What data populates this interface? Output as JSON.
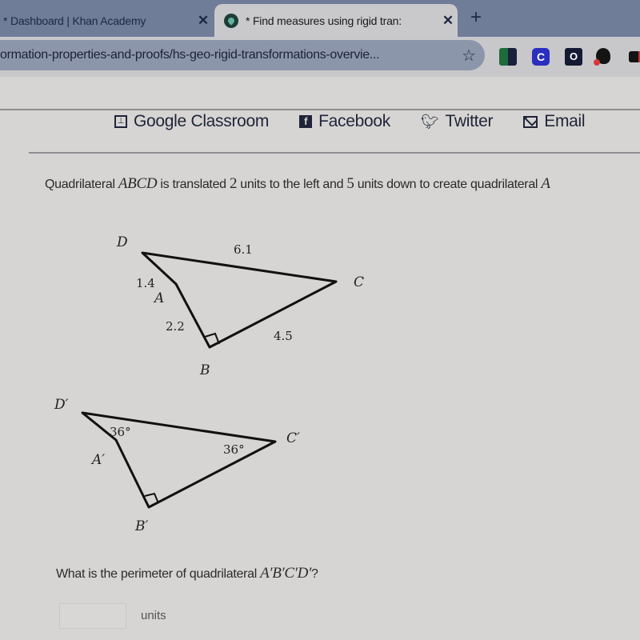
{
  "browser": {
    "tabs": [
      {
        "title": "* Dashboard | Khan Academy",
        "active": false,
        "close_label": "✕"
      },
      {
        "title": "* Find measures using rigid tran:",
        "active": true,
        "close_label": "✕"
      }
    ],
    "new_tab_label": "+",
    "url": "ormation-properties-and-proofs/hs-geo-rigid-transformations-overvie...",
    "star_icon": "☆",
    "extensions": [
      {
        "name": "green-navy-extension",
        "glyph": ""
      },
      {
        "name": "c-extension",
        "glyph": "C"
      },
      {
        "name": "o-extension",
        "glyph": "O"
      },
      {
        "name": "blob-extension",
        "glyph": ""
      },
      {
        "name": "red-extension",
        "glyph": ""
      }
    ]
  },
  "share": {
    "items": [
      {
        "label": "Google Classroom",
        "icon": "classroom-icon"
      },
      {
        "label": "Facebook",
        "icon": "facebook-icon"
      },
      {
        "label": "Twitter",
        "icon": "twitter-icon"
      },
      {
        "label": "Email",
        "icon": "email-icon"
      }
    ]
  },
  "question": {
    "part1": "Quadrilateral ",
    "shape1": "ABCD",
    "part2": " is translated ",
    "n1": "2",
    "part3": " units to the left and ",
    "n2": "5",
    "part4": " units down to create quadrilateral ",
    "shape2": "A"
  },
  "figure_original": {
    "vertices": {
      "A": "A",
      "B": "B",
      "C": "C",
      "D": "D"
    },
    "sides": {
      "DC": "6.1",
      "DA": "1.4",
      "AB": "2.2",
      "BC": "4.5"
    },
    "right_angle_at": "B"
  },
  "figure_image": {
    "vertices": {
      "A": "A′",
      "B": "B′",
      "C": "C′",
      "D": "D′"
    },
    "angles": {
      "D": "36°",
      "C": "36°"
    },
    "right_angle_at": "B′"
  },
  "prompt": {
    "text": "What is the perimeter of quadrilateral ",
    "shape": "A′B′C′D′",
    "end": "?"
  },
  "answer": {
    "value": "",
    "placeholder": "",
    "units": "units"
  }
}
